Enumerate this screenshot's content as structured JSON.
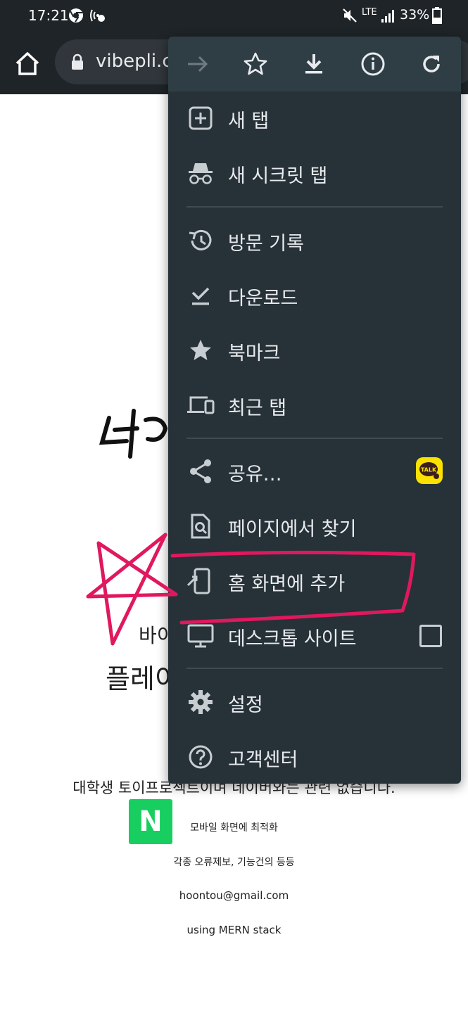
{
  "status_bar": {
    "time": "17:21",
    "network": "LTE",
    "battery": "33%"
  },
  "toolbar": {
    "url": "vibepli.com"
  },
  "page": {
    "text_line_1": "바이",
    "text_line_2": "플레이",
    "naver_letter": "N",
    "disclaimer": "대학생 토이프로젝트이며 네이버와는 관련 없습니다.",
    "footer": [
      "모바일 화면에 최적화",
      "각종 오류제보, 기능건의 등등",
      "hoontou@gmail.com",
      "using MERN stack"
    ]
  },
  "menu": {
    "items": [
      {
        "label": "새 탭",
        "icon": "new-tab-icon"
      },
      {
        "label": "새 시크릿 탭",
        "icon": "incognito-icon"
      },
      {
        "label": "방문 기록",
        "icon": "history-icon"
      },
      {
        "label": "다운로드",
        "icon": "download-done-icon"
      },
      {
        "label": "북마크",
        "icon": "star-filled-icon"
      },
      {
        "label": "최근 탭",
        "icon": "devices-icon"
      },
      {
        "label": "공유…",
        "icon": "share-icon"
      },
      {
        "label": "페이지에서 찾기",
        "icon": "find-in-page-icon"
      },
      {
        "label": "홈 화면에 추가",
        "icon": "add-to-home-icon"
      },
      {
        "label": "데스크톱 사이트",
        "icon": "desktop-icon"
      },
      {
        "label": "설정",
        "icon": "settings-icon"
      },
      {
        "label": "고객센터",
        "icon": "help-icon"
      }
    ],
    "share_app_badge": "TALK"
  },
  "colors": {
    "menu_bg": "#263238",
    "menu_top_bg": "#2f3e45",
    "chrome_bar": "#1f2428",
    "annotation": "#e0185e",
    "naver_green": "#19ce60"
  }
}
